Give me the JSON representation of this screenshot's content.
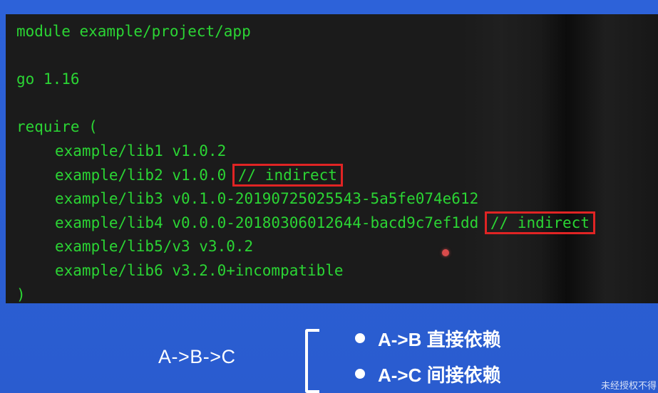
{
  "code": {
    "lines": [
      "module example/project/app",
      "",
      "go 1.16",
      "",
      "require (",
      "example/lib1 v1.0.2",
      "example/lib2 v1.0.0",
      "example/lib3 v0.1.0-20190725025543-5a5fe074e612",
      "example/lib4 v0.0.0-20180306012644-bacd9c7ef1dd",
      "example/lib5/v3 v3.0.2",
      "example/lib6 v3.2.0+incompatible",
      ")"
    ],
    "indirect_comment": "// indirect",
    "colors": {
      "text": "#2bd534",
      "background": "#1b1b1b",
      "highlight_box": "#e02424"
    }
  },
  "legend": {
    "chain": "A->B->C",
    "items": [
      "A->B 直接依赖",
      "A->C 间接依赖"
    ]
  },
  "watermark": "未经授权不得"
}
